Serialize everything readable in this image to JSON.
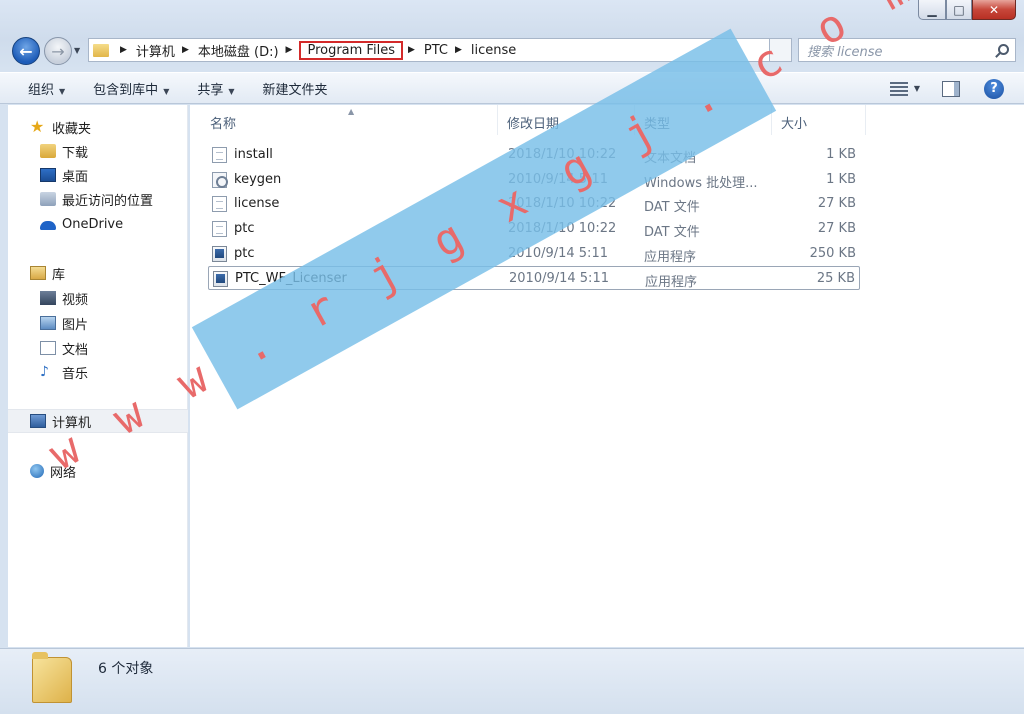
{
  "window": {
    "min": "▁",
    "max": "□",
    "close": "✕"
  },
  "address": {
    "crumbs": [
      "计算机",
      "本地磁盘 (D:)",
      "Program Files",
      "PTC",
      "license"
    ]
  },
  "search": {
    "placeholder": "搜索 license"
  },
  "toolbar": {
    "organize": "组织",
    "include_in_library": "包含到库中",
    "share": "共享",
    "new_folder": "新建文件夹",
    "help": "?"
  },
  "nav": {
    "favorites": "收藏夹",
    "downloads": "下载",
    "desktop": "桌面",
    "recent": "最近访问的位置",
    "onedrive": "OneDrive",
    "libraries": "库",
    "videos": "视频",
    "pictures": "图片",
    "documents": "文档",
    "music": "音乐",
    "computer": "计算机",
    "network": "网络"
  },
  "columns": {
    "name": "名称",
    "date": "修改日期",
    "type": "类型",
    "size": "大小"
  },
  "files": [
    {
      "name": "install",
      "date": "2018/1/10 10:22",
      "type": "文本文档",
      "size": "1 KB",
      "icon": "text-file-icon"
    },
    {
      "name": "keygen",
      "date": "2010/9/14 5:11",
      "type": "Windows 批处理...",
      "size": "1 KB",
      "icon": "batch-file-icon"
    },
    {
      "name": "license",
      "date": "2018/1/10 10:22",
      "type": "DAT 文件",
      "size": "27 KB",
      "icon": "dat-file-icon"
    },
    {
      "name": "ptc",
      "date": "2018/1/10 10:22",
      "type": "DAT 文件",
      "size": "27 KB",
      "icon": "dat-file-icon"
    },
    {
      "name": "ptc",
      "date": "2010/9/14 5:11",
      "type": "应用程序",
      "size": "250 KB",
      "icon": "exe-file-icon"
    },
    {
      "name": "PTC_WF_Licenser",
      "date": "2010/9/14 5:11",
      "type": "应用程序",
      "size": "25 KB",
      "icon": "exe-file-icon"
    }
  ],
  "status": {
    "count": "6 个对象"
  },
  "watermark": {
    "text": "w w w . r j g x g j . c o m"
  },
  "colors": {
    "highlight_box": "#d32a2a",
    "watermark_band": "#78bee8",
    "watermark_text": "#e86a6a"
  }
}
